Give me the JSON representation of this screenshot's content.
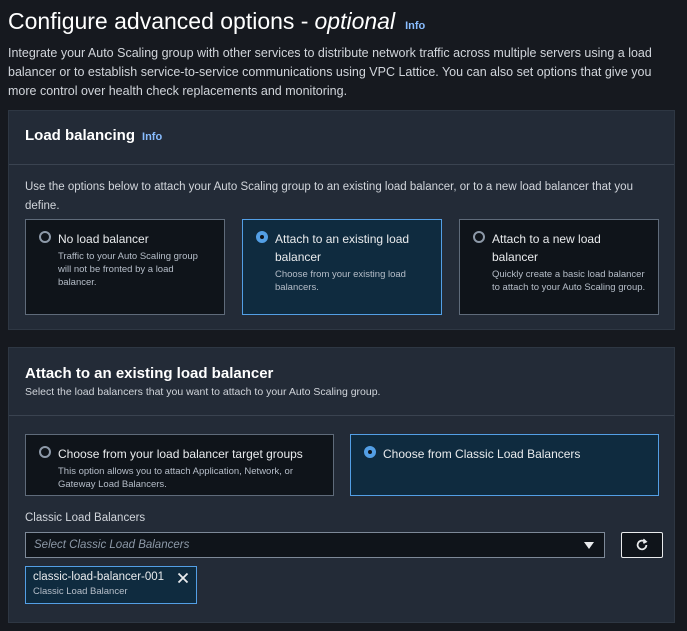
{
  "header": {
    "title": "Configure advanced options - ",
    "title_optional": "optional",
    "info": "Info",
    "description": "Integrate your Auto Scaling group with other services to distribute network traffic across multiple servers using a load balancer or to establish service-to-service communications using VPC Lattice. You can also set options that give you more control over health check replacements and monitoring."
  },
  "load_balancing": {
    "title": "Load balancing",
    "info": "Info",
    "description": "Use the options below to attach your Auto Scaling group to an existing load balancer, or to a new load balancer that you define.",
    "options": [
      {
        "label": "No load balancer",
        "desc": "Traffic to your Auto Scaling group will not be fronted by a load balancer.",
        "selected": false
      },
      {
        "label": "Attach to an existing load balancer",
        "desc": "Choose from your existing load balancers.",
        "selected": true
      },
      {
        "label": "Attach to a new load balancer",
        "desc": "Quickly create a basic load balancer to attach to your Auto Scaling group.",
        "selected": false
      }
    ]
  },
  "existing_lb": {
    "title": "Attach to an existing load balancer",
    "subtitle": "Select the load balancers that you want to attach to your Auto Scaling group.",
    "options": [
      {
        "label": "Choose from your load balancer target groups",
        "desc": "This option allows you to attach Application, Network, or Gateway Load Balancers.",
        "selected": false
      },
      {
        "label": "Choose from Classic Load Balancers",
        "desc": "",
        "selected": true
      }
    ],
    "field_label": "Classic Load Balancers",
    "select_placeholder": "Select Classic Load Balancers",
    "token": {
      "name": "classic-load-balancer-001",
      "type": "Classic Load Balancer"
    }
  },
  "colors": {
    "background": "#16191f",
    "panel": "#232b37",
    "accent": "#539fe5",
    "link": "#89bdff"
  },
  "icons": {
    "refresh": "refresh-icon",
    "remove": "close-icon",
    "dropdown": "caret-down-icon"
  }
}
